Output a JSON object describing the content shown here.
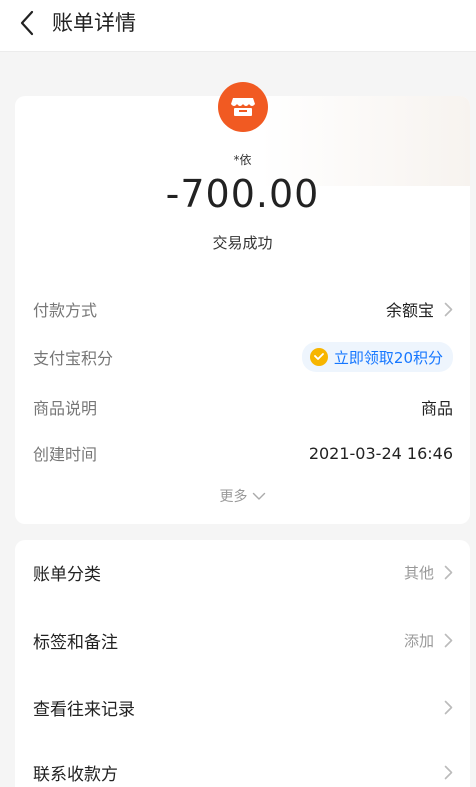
{
  "nav": {
    "title": "账单详情",
    "back_icon": "chevron-left-icon"
  },
  "bill": {
    "store_icon": "store-icon",
    "store_icon_color": "#f15a22",
    "payee": "*依",
    "amount": "-700.00",
    "status": "交易成功",
    "rows": [
      {
        "label": "付款方式",
        "value": "余额宝"
      },
      {
        "label": "支付宝积分",
        "value": "立即领取20积分"
      },
      {
        "label": "商品说明",
        "value": "商品"
      },
      {
        "label": "创建时间",
        "value": "2021-03-24 16:46"
      }
    ],
    "more_label": "更多"
  },
  "actions": [
    {
      "label": "账单分类",
      "value": "其他"
    },
    {
      "label": "标签和备注",
      "value": "添加"
    },
    {
      "label": "查看往来记录",
      "value": ""
    },
    {
      "label": "联系收款方",
      "value": ""
    }
  ],
  "colors": {
    "link_blue": "#1677ff",
    "coin_yellow": "#f7b500"
  }
}
